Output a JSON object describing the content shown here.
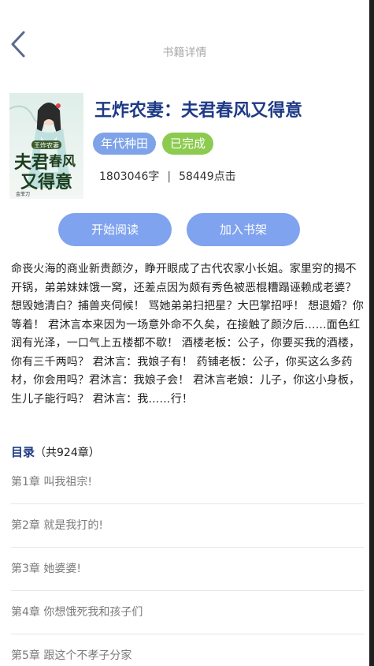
{
  "header": {
    "title": "书籍详情",
    "back_icon": "chevron-left-icon"
  },
  "book": {
    "title": "王炸农妻：夫君春风又得意",
    "tags": [
      "年代种田",
      "已完成"
    ],
    "word_count": "1803046字",
    "separator": "|",
    "clicks": "58449点击",
    "cover": {
      "title": "夫君春风又得意",
      "subtitle": "王炸农妻",
      "author": "金菲刀"
    }
  },
  "actions": {
    "start_reading": "开始阅读",
    "add_to_shelf": "加入书架"
  },
  "intro": "命丧火海的商业新贵颜汐，睁开眼成了古代农家小长姐。家里穷的揭不开锅，弟弟妹妹饿一窝，还差点因为颇有秀色被恶棍糟蹋诬赖成老婆？ 想毁她清白？捕兽夹伺候！ 骂她弟弟扫把星？大巴掌招呼！ 想退婚？你等着！ 君沐言本来因为一场意外命不久矣，在接触了颜汐后……面色红润有光泽，一口气上五楼都不歇！ 酒楼老板：公子，你要买我的酒楼，你有三千两吗？ 君沐言：我娘子有！ 药铺老板：公子，你买这么多药材，你会用吗？君沐言：我娘子会！ 君沐言老娘：儿子，你这小身板，生儿子能行吗？ 君沐言：我……行！",
  "toc": {
    "label": "目录",
    "count": "（共924章）",
    "chapters": [
      "第1章 叫我祖宗!",
      "第2章 就是我打的!",
      "第3章 她婆婆!",
      "第4章 你想饿死我和孩子们",
      "第5章 跟这个不孝子分家"
    ]
  },
  "colors": {
    "title": "#1e3a86",
    "tag_blue": "#7fa3e8",
    "tag_green": "#8ccb4f",
    "button": "#7fa3ee"
  }
}
